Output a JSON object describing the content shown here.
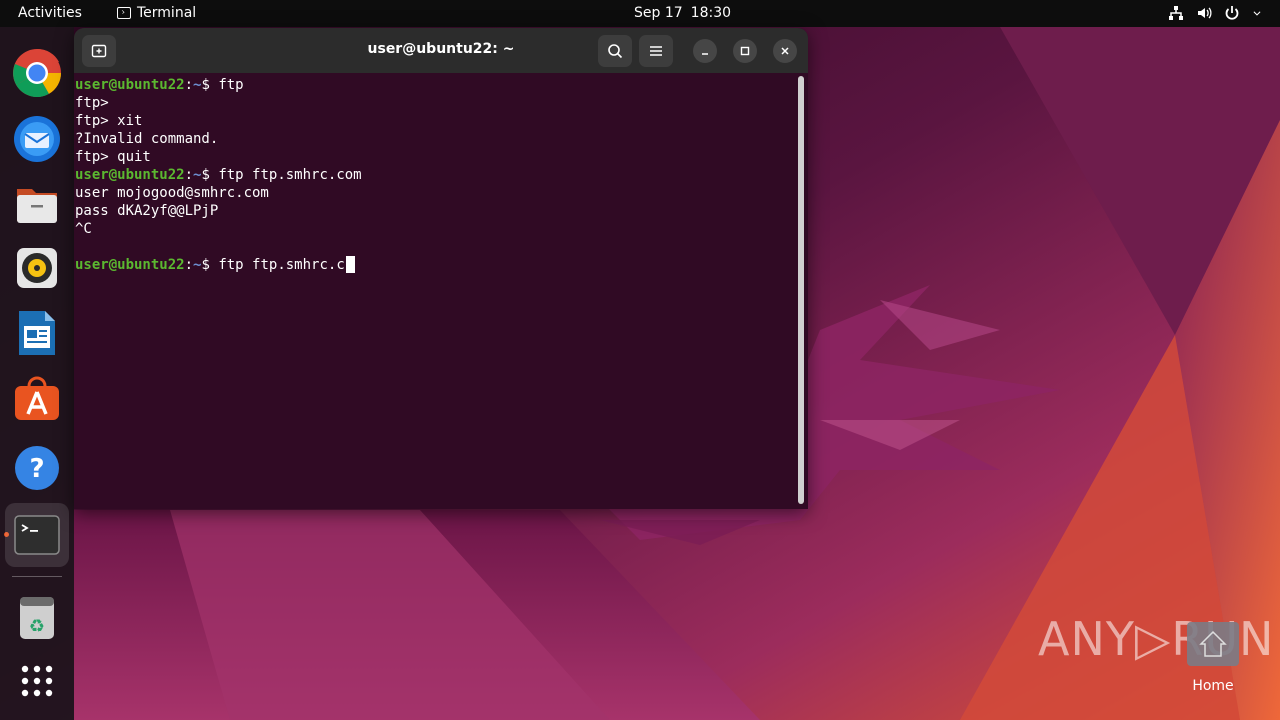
{
  "topbar": {
    "activities": "Activities",
    "app_name": "Terminal",
    "date": "Sep 17",
    "time": "18:30",
    "tray_icons": [
      "network-icon",
      "volume-icon",
      "power-icon"
    ]
  },
  "dock": {
    "apps": [
      "chrome-icon",
      "thunderbird-icon",
      "files-icon",
      "rhythmbox-icon",
      "writer-icon",
      "app-center-icon",
      "help-icon",
      "terminal-icon",
      "trash-icon",
      "show-apps-icon"
    ]
  },
  "terminal": {
    "title": "user@ubuntu22: ~",
    "prompt_user": "user@ubuntu22",
    "prompt_sep": ":",
    "prompt_path": "~",
    "prompt_dollar": "$ ",
    "lines": [
      {
        "type": "prompt",
        "cmd": "ftp"
      },
      {
        "type": "out",
        "text": "ftp>"
      },
      {
        "type": "out",
        "text": "ftp> xit"
      },
      {
        "type": "out",
        "text": "?Invalid command."
      },
      {
        "type": "out",
        "text": "ftp> quit"
      },
      {
        "type": "prompt",
        "cmd": "ftp ftp.smhrc.com"
      },
      {
        "type": "out",
        "text": "user mojogood@smhrc.com"
      },
      {
        "type": "out",
        "text": "pass dKA2yf@@LPjP"
      },
      {
        "type": "out",
        "text": "^C"
      },
      {
        "type": "out",
        "text": ""
      },
      {
        "type": "prompt",
        "cmd": "ftp ftp.smhrc.c",
        "cursor": true
      }
    ]
  },
  "desktop": {
    "watermark": "ANY RUN",
    "home_label": "Home",
    "colors": {
      "bg_dark": "#3b0a2a",
      "bg_mid": "#7a1f4f",
      "bg_orange": "#d9542b",
      "terminal_bg": "#300a24",
      "accent": "#e95420"
    }
  }
}
